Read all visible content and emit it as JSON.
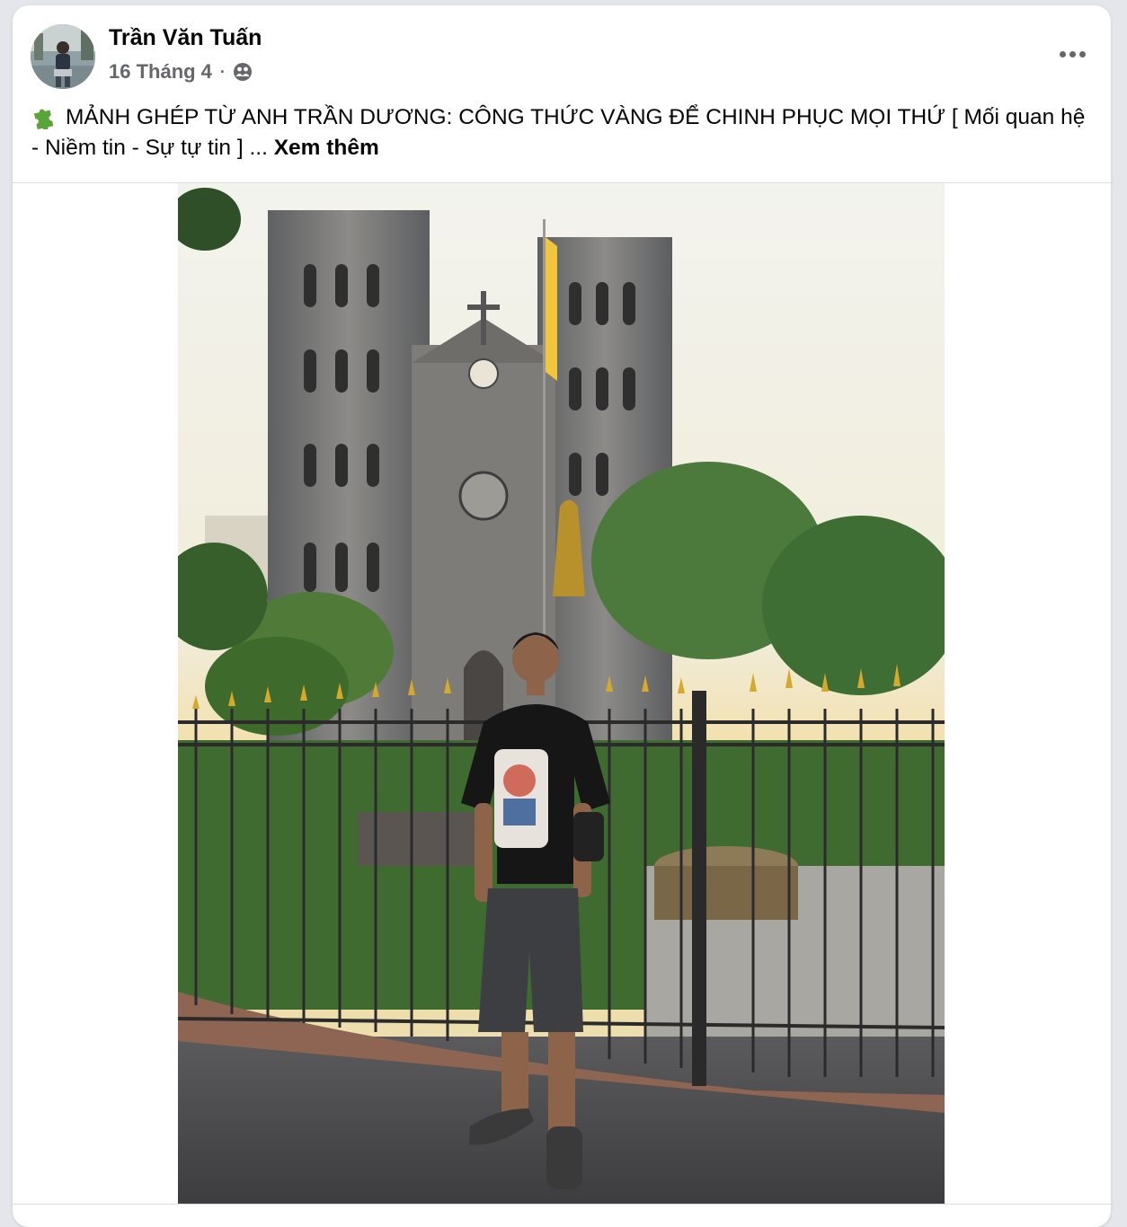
{
  "post": {
    "author_name": "Trần Văn Tuấn",
    "date": "16 Tháng 4",
    "separator": "·",
    "privacy_icon": "friends-icon",
    "more_icon": "more-options-icon",
    "caption_icon": "puzzle-piece-icon",
    "caption_text": "MẢNH GHÉP TỪ ANH TRẦN DƯƠNG: CÔNG THỨC VÀNG ĐỂ CHINH PHỤC MỌI THỨ [ Mối quan hệ - Niềm tin - Sự tự tin ] ...",
    "see_more": "Xem thêm"
  },
  "colors": {
    "card_bg": "#ffffff",
    "page_bg": "#e4e6eb",
    "text_primary": "#050505",
    "text_secondary": "#65676b",
    "puzzle_green": "#5aa53a"
  }
}
